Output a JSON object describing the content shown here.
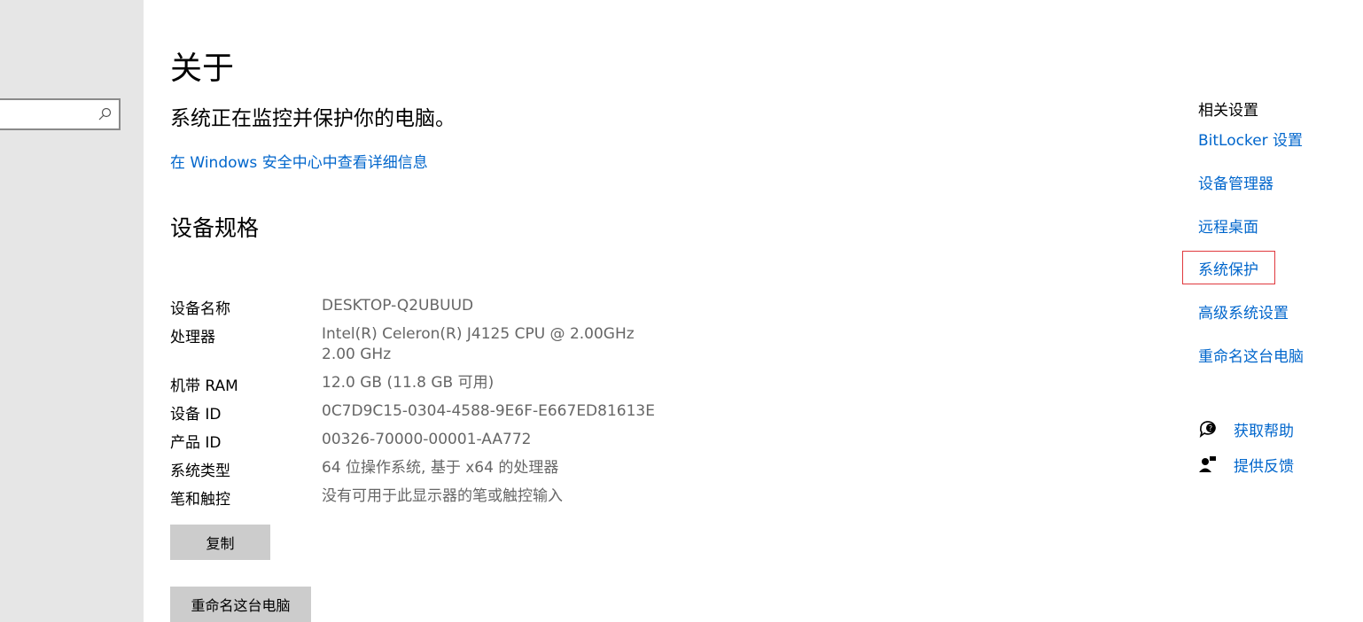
{
  "search": {
    "placeholder": "",
    "icon": "search-icon"
  },
  "page": {
    "title": "关于",
    "status_text": "系统正在监控并保护你的电脑。",
    "security_link": "在 Windows 安全中心中查看详细信息",
    "section_title": "设备规格"
  },
  "specs": [
    {
      "label": "设备名称",
      "value": "DESKTOP-Q2UBUUD"
    },
    {
      "label": "处理器",
      "value": "Intel(R) Celeron(R) J4125 CPU @ 2.00GHz   2.00 GHz"
    },
    {
      "label": "机带 RAM",
      "value": "12.0 GB (11.8 GB 可用)"
    },
    {
      "label": "设备 ID",
      "value": "0C7D9C15-0304-4588-9E6F-E667ED81613E"
    },
    {
      "label": "产品 ID",
      "value": "00326-70000-00001-AA772"
    },
    {
      "label": "系统类型",
      "value": "64 位操作系统, 基于 x64 的处理器"
    },
    {
      "label": "笔和触控",
      "value": "没有可用于此显示器的笔或触控输入"
    }
  ],
  "buttons": {
    "copy": "复制",
    "rename": "重命名这台电脑"
  },
  "related": {
    "title": "相关设置",
    "links": [
      "BitLocker 设置",
      "设备管理器",
      "远程桌面",
      "系统保护",
      "高级系统设置",
      "重命名这台电脑"
    ],
    "highlighted": "系统保护"
  },
  "help": {
    "get_help": "获取帮助",
    "feedback": "提供反馈"
  },
  "colors": {
    "link": "#0066cc",
    "highlight_border": "#e0393e",
    "sidebar_bg": "#e6e6e6",
    "button_bg": "#cccccc"
  }
}
